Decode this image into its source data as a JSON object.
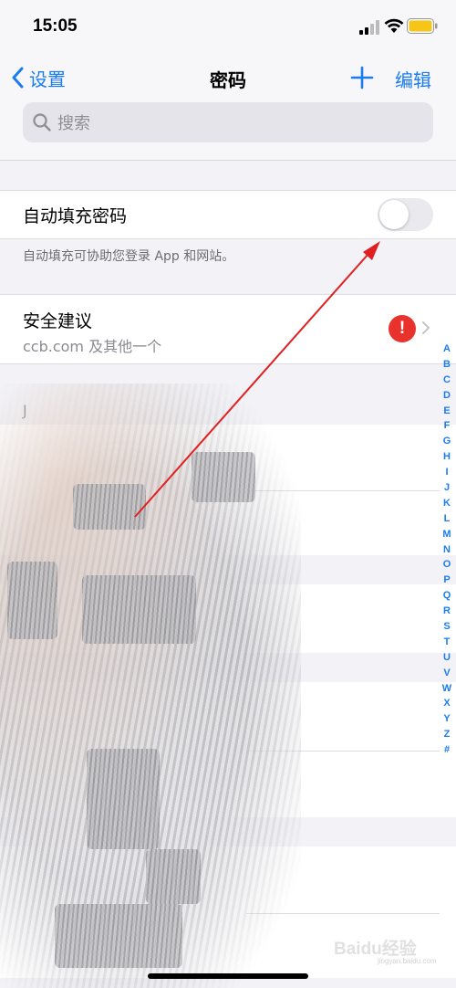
{
  "status": {
    "time": "15:05"
  },
  "nav": {
    "back_label": "设置",
    "title": "密码",
    "edit_label": "编辑"
  },
  "search": {
    "placeholder": "搜索"
  },
  "autofill": {
    "label": "自动填充密码",
    "enabled": false,
    "footnote": "自动填充可协助您登录 App 和网站。"
  },
  "security": {
    "title": "安全建议",
    "subtitle": "ccb.com 及其他一个",
    "badge": "!"
  },
  "list": {
    "section_header": "J"
  },
  "index": [
    "A",
    "B",
    "C",
    "D",
    "E",
    "F",
    "G",
    "H",
    "I",
    "J",
    "K",
    "L",
    "M",
    "N",
    "O",
    "P",
    "Q",
    "R",
    "S",
    "T",
    "U",
    "V",
    "W",
    "X",
    "Y",
    "Z",
    "#"
  ],
  "watermark": {
    "text": "Baidu经验",
    "sub": "jingyan.baidu.com"
  },
  "colors": {
    "accent": "#1a7cf0",
    "warning": "#e8322b",
    "annotation": "#e02020"
  }
}
